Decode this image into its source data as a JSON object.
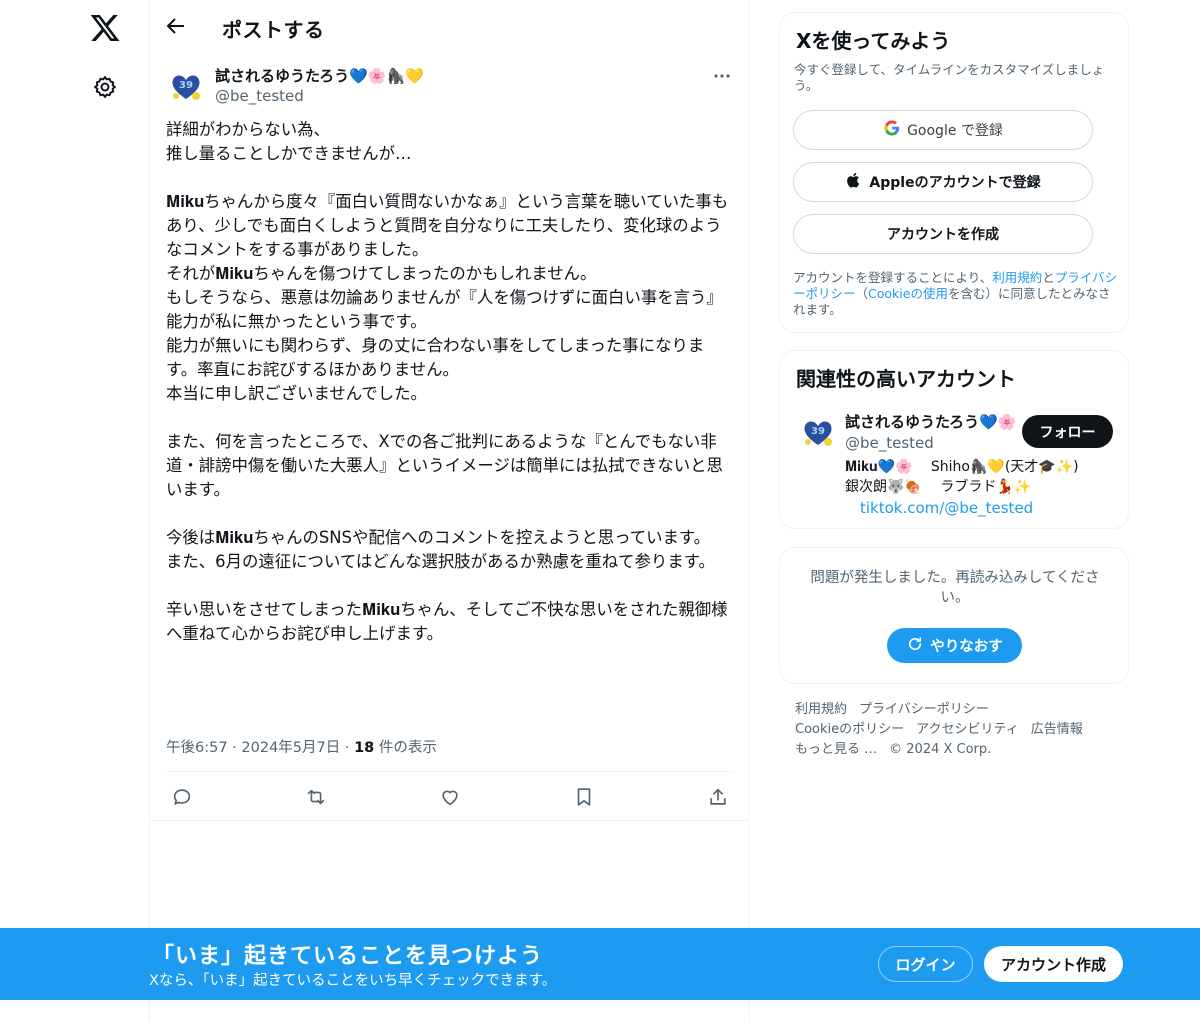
{
  "header": {
    "back_label": "←",
    "title": "ポストする"
  },
  "post": {
    "author_name": "試されるゆうたろう💙🌸🦍💛",
    "author_handle": "@be_tested",
    "body": "詳細がわからない為、\n推し量ることしかできませんが…\n\n𝐌𝐢𝐤𝐮ちゃんから度々『面白い質問ないかなぁ』という言葉を聴いていた事もあり、少しでも面白くしようと質問を自分なりに工夫したり、変化球のようなコメントをする事がありました。\nそれが𝐌𝐢𝐤𝐮ちゃんを傷つけてしまったのかもしれません。\nもしそうなら、悪意は勿論ありませんが『人を傷つけずに面白い事を言う』\n能力が私に無かったという事です。\n能力が無いにも関わらず、身の丈に合わない事をしてしまった事になります。率直にお詫びするほかありません。\n本当に申し訳ございませんでした。\n\nまた、何を言ったところで、Xでの各ご批判にあるような『とんでもない非道・誹謗中傷を働いた大悪人』というイメージは簡単には払拭できないと思います。\n\n今後は𝐌𝐢𝐤𝐮ちゃんのSNSや配信へのコメントを控えようと思っています。\nまた、6月の遠征についてはどんな選択肢があるか熟慮を重ねて参ります。\n\n辛い思いをさせてしまった𝐌𝐢𝐤𝐮ちゃん、そしてご不快な思いをされた親御様へ重ねて心からお詫び申し上げます。",
    "time": "午後6:57",
    "date": "2024年5月7日",
    "views_count": "18",
    "views_label": "件の表示",
    "separator": "·"
  },
  "signup_card": {
    "title": "Xを使ってみよう",
    "subtitle": "今すぐ登録して、タイムラインをカスタマイズしましょう。",
    "google_label": "Google で登録",
    "apple_label": "Appleのアカウントで登録",
    "create_label": "アカウントを作成",
    "terms_prefix": "アカウントを登録することにより、",
    "terms_link1": "利用規約",
    "terms_and": "と",
    "terms_link2": "プライバシーポリシー",
    "terms_paren_open": "（",
    "terms_link3": "Cookieの使用",
    "terms_suffix": "を含む）に同意したとみなされます。"
  },
  "related": {
    "title": "関連性の高いアカウント",
    "name": "試されるゆうたろう💙🌸",
    "handle": "@be_tested",
    "follow_label": "フォロー",
    "bio": "𝐌𝐢𝐤𝐮💙🌸　 Shiho🦍💛(天才🎓✨)\n銀次朗🐺🍖　 ラブラド💃✨",
    "link": "tiktok.com/@be_tested"
  },
  "error_card": {
    "message": "問題が発生しました。再読み込みしてください。",
    "retry_label": "やりなおす"
  },
  "footer": {
    "links": [
      "利用規約",
      "プライバシーポリシー",
      "Cookieのポリシー",
      "アクセシビリティ",
      "広告情報",
      "もっと見る …",
      "© 2024 X Corp."
    ]
  },
  "banner": {
    "title": "「いま」起きていることを見つけよう",
    "subtitle": "Xなら、「いま」起きていることをいち早くチェックできます。",
    "login_label": "ログイン",
    "signup_label": "アカウント作成"
  },
  "colors": {
    "accent": "#1d9bf0",
    "text": "#0f1419",
    "muted": "#536471",
    "border": "#eff3f4"
  }
}
